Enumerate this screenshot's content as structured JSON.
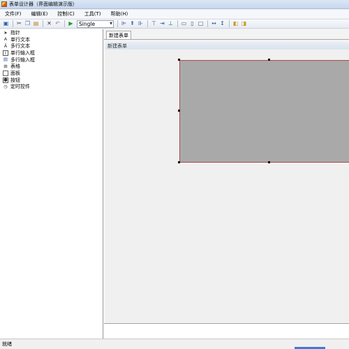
{
  "window": {
    "title": "表单设计器（界面编辑演示版）"
  },
  "menu": [
    {
      "label": "文件(F)"
    },
    {
      "label": "编辑(E)"
    },
    {
      "label": "控制(C)"
    },
    {
      "label": "工具(T)"
    },
    {
      "label": "帮助(H)"
    }
  ],
  "toolbar": {
    "mode_value": "Single"
  },
  "toolbox": {
    "items": [
      {
        "label": "指针",
        "icon": "pointer-icon"
      },
      {
        "label": "单行文本",
        "icon": "text-icon"
      },
      {
        "label": "多行文本",
        "icon": "multiline-text-icon"
      },
      {
        "label": "单行输入框",
        "icon": "textbox-icon"
      },
      {
        "label": "多行输入框",
        "icon": "multiline-textbox-icon"
      },
      {
        "label": "表格",
        "icon": "table-icon"
      },
      {
        "label": "面板",
        "icon": "panel-icon"
      },
      {
        "label": "按钮",
        "icon": "button-icon"
      },
      {
        "label": "定时控件",
        "icon": "timer-icon"
      }
    ]
  },
  "designer": {
    "tab_label": "新建表单",
    "form_title": "新建表单"
  },
  "status": {
    "text": "就绪"
  }
}
